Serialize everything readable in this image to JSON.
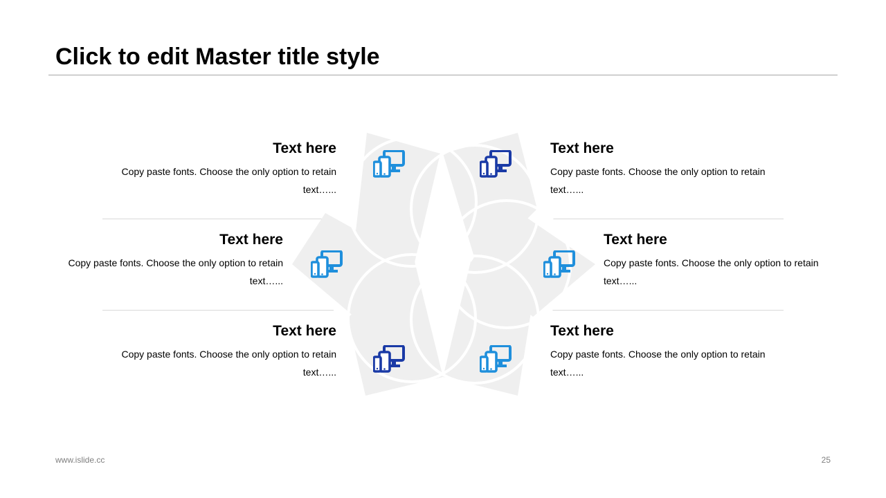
{
  "slide": {
    "title": "Click to edit Master title style",
    "footer_left": "www.islide.cc",
    "page_number": "25"
  },
  "colors": {
    "petal_fill": "#efefef",
    "icon_light_blue": "#1f8fdc",
    "icon_dark_blue": "#1a3aa6",
    "divider": "#d9d9d9"
  },
  "items": [
    {
      "heading": "Text here",
      "body": "Copy paste fonts. Choose the only option to retain text…...",
      "icon": "devices-icon",
      "icon_color": "#1f8fdc"
    },
    {
      "heading": "Text here",
      "body": "Copy paste fonts. Choose the only option to retain text…...",
      "icon": "devices-icon",
      "icon_color": "#1a3aa6"
    },
    {
      "heading": "Text here",
      "body": "Copy paste fonts. Choose the only option to retain text…...",
      "icon": "devices-icon",
      "icon_color": "#1f8fdc"
    },
    {
      "heading": "Text here",
      "body": "Copy paste fonts. Choose the only option to retain text…...",
      "icon": "devices-icon",
      "icon_color": "#1f8fdc"
    },
    {
      "heading": "Text here",
      "body": "Copy paste fonts. Choose the only option to retain text…...",
      "icon": "devices-icon",
      "icon_color": "#1a3aa6"
    },
    {
      "heading": "Text here",
      "body": "Copy paste fonts. Choose the only option to retain text…...",
      "icon": "devices-icon",
      "icon_color": "#1f8fdc"
    }
  ]
}
